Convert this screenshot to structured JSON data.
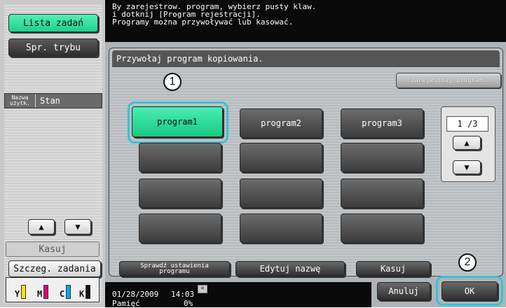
{
  "left_panel": {
    "job_list_label": "Lista zadań",
    "mode_check_label": "Spr. trybu",
    "col_user_label": "Nazwa użytk.",
    "col_status_label": "Stan",
    "delete_label": "Kasuj",
    "job_details_label": "Szczeg. zadania",
    "toners": [
      "Y",
      "M",
      "C",
      "K"
    ]
  },
  "colors": {
    "yellow": "#f5e400",
    "magenta": "#e2007a",
    "cyan": "#00a9e6",
    "black": "#111111",
    "accent_green": "#1fd08a",
    "highlight_ring": "#35c2d9"
  },
  "message": {
    "line1": "By zarejestrow. program, wybierz pusty klaw.",
    "line2": "i dotknij [Program rejestracji].",
    "line3": "Programy można przywoływać lub kasować."
  },
  "panel": {
    "title": "Przywołaj program kopiowania.",
    "register_button": "Zarejestruj program.",
    "programs": [
      "program1",
      "program2",
      "program3"
    ],
    "page_indicator": "1 /3"
  },
  "bottom_buttons": {
    "check_settings": "Sprawdź ustawienia programu",
    "edit_name": "Edytuj nazwę",
    "delete": "Kasuj",
    "cancel": "Anuluj",
    "ok": "OK"
  },
  "status": {
    "date": "01/28/2009",
    "time": "14:03",
    "memory_label": "Pamięć",
    "memory_value": "0%"
  },
  "callouts": [
    "1",
    "2"
  ]
}
